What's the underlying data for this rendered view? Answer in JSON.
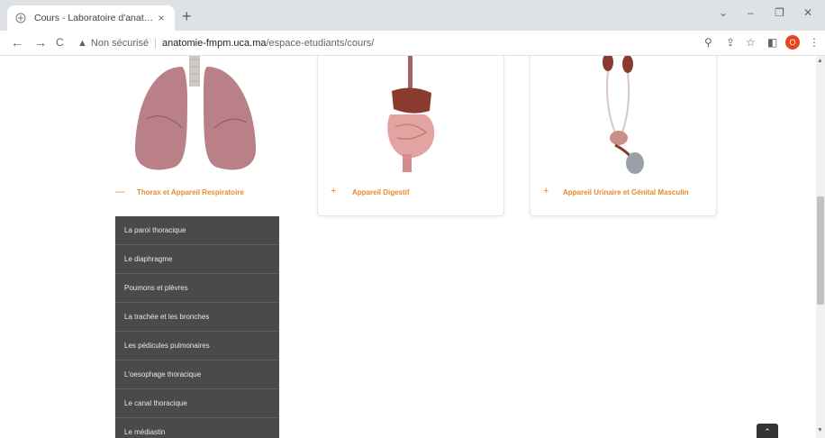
{
  "browser": {
    "tab_title": "Cours - Laboratoire d'anatomie",
    "tab_close": "×",
    "new_tab": "+",
    "back": "←",
    "forward": "→",
    "reload": "C",
    "security_icon": "▲",
    "security_label": "Non sécurisé",
    "url_host": "anatomie-fmpm.uca.ma",
    "url_path": "/espace-etudiants/cours/",
    "profile_initial": "O"
  },
  "cards": [
    {
      "label": "Thorax et Appareil Respiratoire",
      "icon": "—",
      "expanded": true
    },
    {
      "label": "Appareil Digestif",
      "icon": "+",
      "expanded": false
    },
    {
      "label": "Appareil Urinaire et Génital Masculin",
      "icon": "+",
      "expanded": false
    }
  ],
  "submenu": {
    "items": [
      "La paroi thoracique",
      "Le diaphragme",
      "Poumons et plèvres",
      "La trachée et les bronches",
      "Les pédicules pulmonaires",
      "L'oesophage thoracique",
      "Le canal thoracique",
      "Le médiastin"
    ]
  },
  "scroll_to_top": "⌃",
  "colors": {
    "accent": "#e8892a",
    "submenu_bg": "#4a4a4a"
  }
}
